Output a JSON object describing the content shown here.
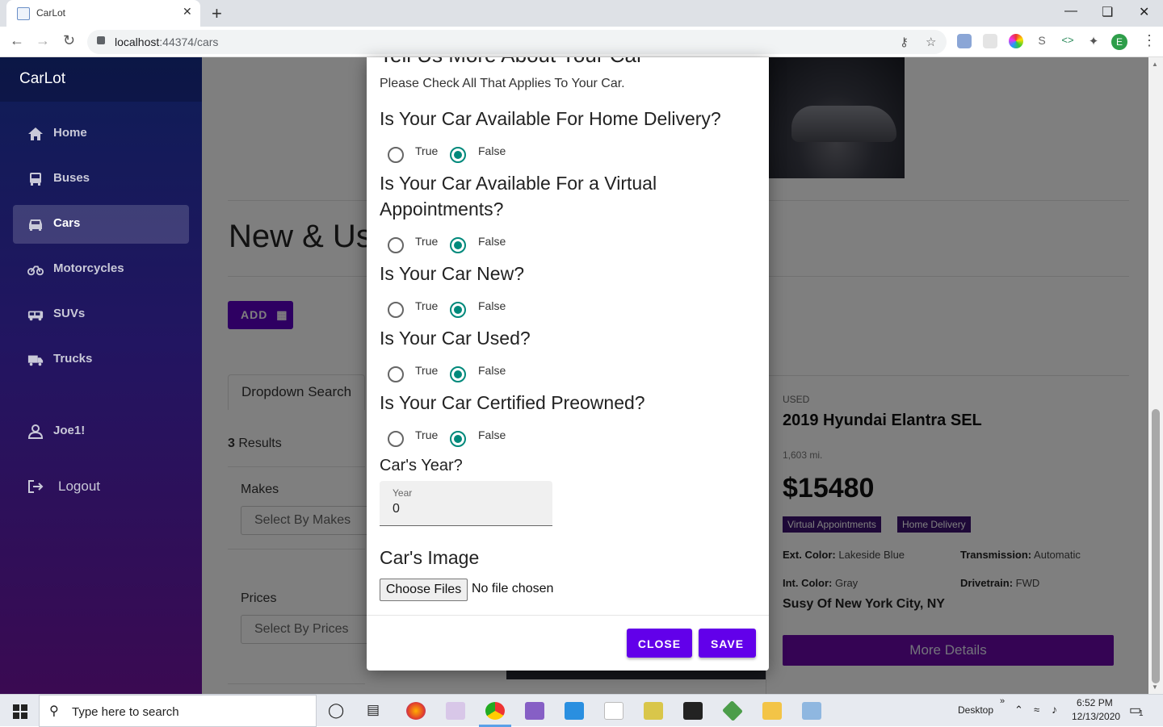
{
  "browser": {
    "tab_title": "CarLot",
    "url_host": "localhost",
    "url_path": ":44374/cars",
    "new_tab_glyph": "+",
    "close_glyph": "✕",
    "profile_initial": "E"
  },
  "sidebar": {
    "brand": "CarLot",
    "items": [
      {
        "label": "Home",
        "icon": "home-icon"
      },
      {
        "label": "Buses",
        "icon": "bus-icon"
      },
      {
        "label": "Cars",
        "icon": "car-icon",
        "active": true
      },
      {
        "label": "Motorcycles",
        "icon": "motorcycle-icon"
      },
      {
        "label": "SUVs",
        "icon": "suv-icon"
      },
      {
        "label": "Trucks",
        "icon": "truck-icon"
      }
    ],
    "user": "Joe1!",
    "logout": "Logout"
  },
  "page": {
    "title": "New & Us",
    "add_label": "ADD",
    "search_tab": "Dropdown Search",
    "results_count": "3",
    "results_label": "Results",
    "makes_label": "Makes",
    "makes_placeholder": "Select By Makes",
    "prices_label": "Prices",
    "prices_placeholder": "Select By Prices"
  },
  "car_card": {
    "condition": "USED",
    "name": "2019 Hyundai Elantra SEL",
    "miles": "1,603 mi.",
    "price": "$15480",
    "badges": [
      "Virtual Appointments",
      "Home Delivery"
    ],
    "ext_color_label": "Ext. Color:",
    "ext_color": "Lakeside Blue",
    "transmission_label": "Transmission:",
    "transmission": "Automatic",
    "int_color_label": "Int. Color:",
    "int_color": "Gray",
    "drivetrain_label": "Drivetrain:",
    "drivetrain": "FWD",
    "location": "Susy Of New York City, NY",
    "details_button": "More Details"
  },
  "modal": {
    "title": "Tell Us More About Your Car",
    "subtitle": "Please Check All That Applies To Your Car.",
    "true_label": "True",
    "false_label": "False",
    "questions": [
      {
        "text": "Is Your Car Available For Home Delivery?",
        "value": false
      },
      {
        "text": "Is Your Car Available For a Virtual Appointments?",
        "value": false
      },
      {
        "text": "Is Your Car New?",
        "value": false
      },
      {
        "text": "Is Your Car Used?",
        "value": false
      },
      {
        "text": "Is Your Car Certified Preowned?",
        "value": false
      }
    ],
    "year_heading": "Car's Year?",
    "year_label": "Year",
    "year_value": "0",
    "image_heading": "Car's Image",
    "file_button": "Choose Files",
    "file_status": "No file chosen",
    "close_button": "CLOSE",
    "save_button": "SAVE"
  },
  "taskbar": {
    "search_placeholder": "Type here to search",
    "desktop_label": "Desktop",
    "time": "6:52 PM",
    "date": "12/13/2020",
    "notification_count": "1"
  },
  "colors": {
    "accent_purple": "#6200ea",
    "radio_checked": "#00897b",
    "badge_bg": "#3c1270"
  }
}
